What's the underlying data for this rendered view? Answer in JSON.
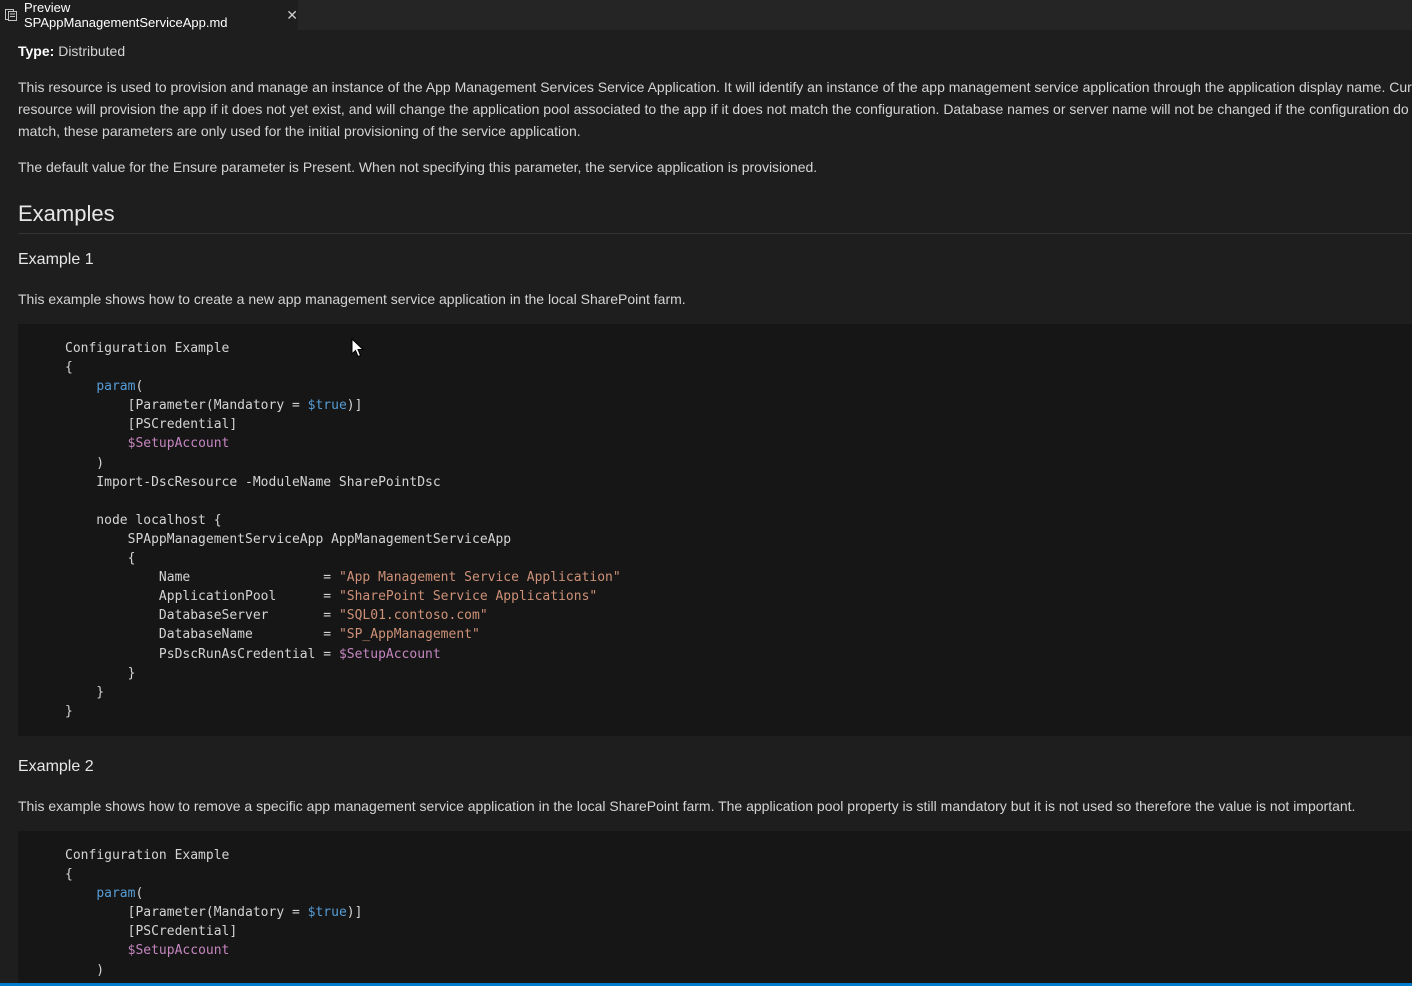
{
  "tab": {
    "title": "Preview SPAppManagementServiceApp.md",
    "close_glyph": "✕",
    "icon": "preview-icon"
  },
  "doc": {
    "type_label": "Type:",
    "type_value": "Distributed",
    "desc_line1": "This resource is used to provision and manage an instance of the App Management Services Service Application. It will identify an instance of the app management service application through the application display name. Curre",
    "desc_line2": "resource will provision the app if it does not yet exist, and will change the application pool associated to the app if it does not match the configuration. Database names or server name will not be changed if the configuration do",
    "desc_line3": "match, these parameters are only used for the initial provisioning of the service application.",
    "ensure_text": "The default value for the Ensure parameter is Present. When not specifying this parameter, the service application is provisioned.",
    "examples_heading": "Examples",
    "example1": {
      "heading": "Example 1",
      "description": "This example shows how to create a new app management service application in the local SharePoint farm.",
      "code": [
        {
          "t": "Configuration Example"
        },
        {
          "t": "{"
        },
        {
          "t": "    "
        },
        {
          "t": "        [Parameter(Mandatory = "
        },
        {
          "t": "        [PSCredential]"
        },
        {
          "t": "        "
        },
        {
          "t": "    )"
        },
        {
          "t": "    Import-DscResource -ModuleName SharePointDsc"
        },
        {
          "t": ""
        },
        {
          "t": "    node localhost {"
        },
        {
          "t": "        SPAppManagementServiceApp AppManagementServiceApp"
        },
        {
          "t": "        {"
        },
        {
          "t": "            Name                 = "
        },
        {
          "t": "            ApplicationPool      = "
        },
        {
          "t": "            DatabaseServer       = "
        },
        {
          "t": "            DatabaseName         = "
        },
        {
          "t": "            PsDscRunAsCredential = "
        },
        {
          "t": "        }"
        },
        {
          "t": "    }"
        },
        {
          "t": "}"
        }
      ],
      "tokens": {
        "param": "param",
        "paren_open": "(",
        "true": "$true",
        "close_attr": ")]",
        "setup_account": "$SetupAccount",
        "name_value": "\"App Management Service Application\"",
        "pool_value": "\"SharePoint Service Applications\"",
        "server_value": "\"SQL01.contoso.com\"",
        "dbname_value": "\"SP_AppManagement\"",
        "credential_value": "$SetupAccount"
      }
    },
    "example2": {
      "heading": "Example 2",
      "description": "This example shows how to remove a specific app management service application in the local SharePoint farm. The application pool property is still mandatory but it is not used so therefore the value is not important.",
      "code": [
        {
          "t": "Configuration Example"
        },
        {
          "t": "{"
        },
        {
          "t": "    "
        },
        {
          "t": "        [Parameter(Mandatory = "
        },
        {
          "t": "        [PSCredential]"
        },
        {
          "t": "        "
        },
        {
          "t": "    )"
        }
      ],
      "tokens": {
        "param": "param",
        "paren_open": "(",
        "true": "$true",
        "close_attr": ")]",
        "setup_account": "$SetupAccount"
      }
    }
  },
  "colors": {
    "background": "#1e1e1e",
    "code_background": "#161616",
    "keyword": "#569cd6",
    "variable": "#c586c0",
    "string": "#ce9178",
    "accent": "#007acc"
  }
}
